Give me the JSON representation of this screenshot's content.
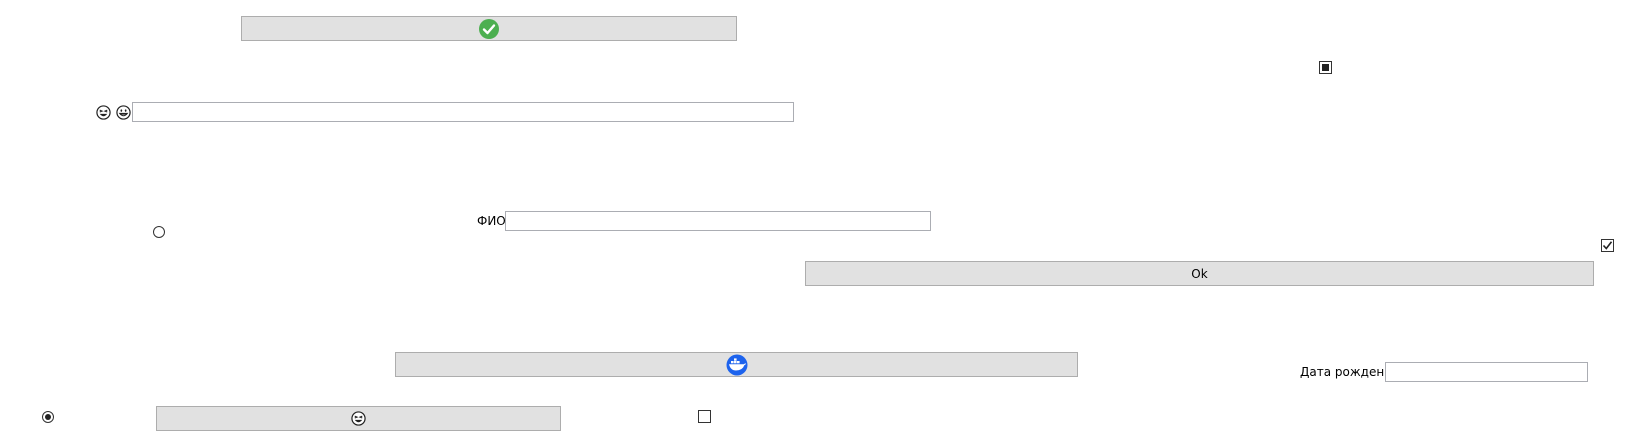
{
  "form": {
    "fio_label": "ФИО",
    "fio_value": "",
    "birth_label": "Дата рождения",
    "birth_value": "",
    "text_field_top_value": "",
    "ok_button_label": "Ok"
  },
  "icons": {
    "top_button_icon": "check-circle-icon",
    "face_icon_1": "grinning-squint-face-icon",
    "face_icon_2": "grinning-face-icon",
    "docker_button_icon": "docker-whale-icon",
    "bottom_button_icon": "grinning-squint-face-icon"
  },
  "controls": {
    "checkbox_top_state": "indeterminate",
    "checkbox_right_state": "checked",
    "checkbox_bottom_state": "unchecked",
    "radio_left_state": "unchecked",
    "radio_bottom_state": "checked"
  },
  "colors": {
    "button_bg": "#e1e1e1",
    "check_green": "#4caf50",
    "docker_blue": "#1d63ed"
  }
}
